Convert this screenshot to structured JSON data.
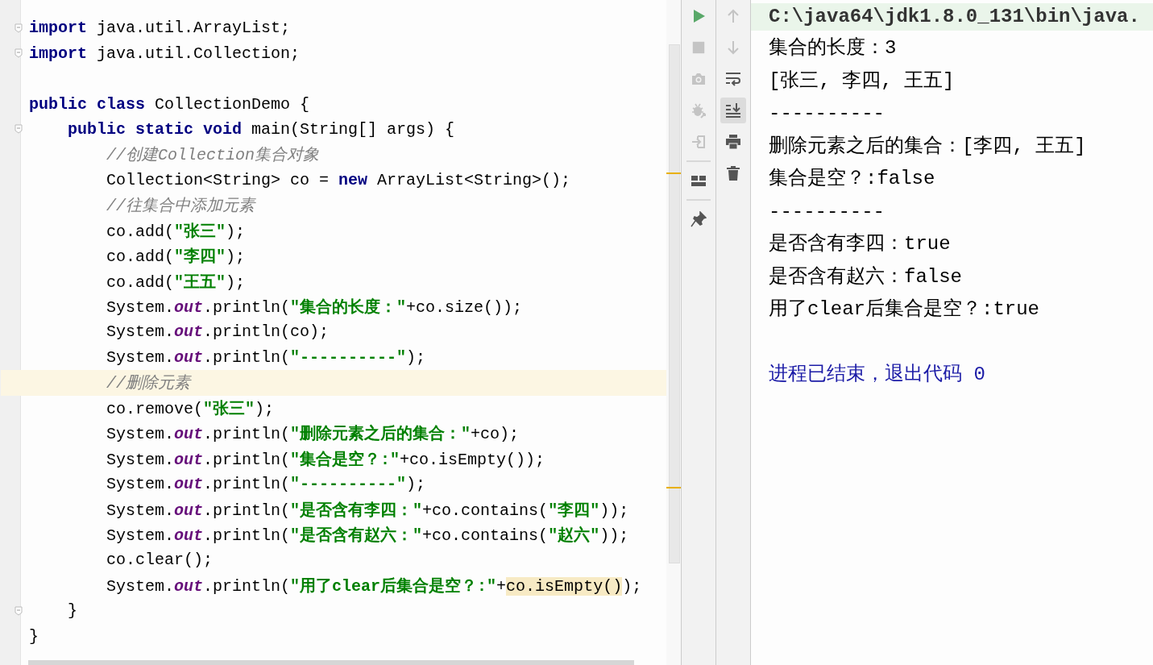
{
  "editor": {
    "lines": [
      {
        "kind": "code",
        "current": false,
        "fold_marker": true,
        "tokens": [
          {
            "kind": "kw",
            "text": "import"
          },
          {
            "kind": "plain",
            "text": " java.util.ArrayList;"
          }
        ]
      },
      {
        "kind": "code",
        "current": false,
        "fold_marker": true,
        "tokens": [
          {
            "kind": "kw",
            "text": "import"
          },
          {
            "kind": "plain",
            "text": " java.util.Collection;"
          }
        ]
      },
      {
        "kind": "blank",
        "current": false,
        "fold_marker": false
      },
      {
        "kind": "code",
        "current": false,
        "fold_marker": false,
        "tokens": [
          {
            "kind": "kw",
            "text": "public class"
          },
          {
            "kind": "plain",
            "text": " CollectionDemo {"
          }
        ]
      },
      {
        "kind": "code",
        "current": false,
        "fold_marker": true,
        "tokens": [
          {
            "kind": "kw",
            "text": "    public static void"
          },
          {
            "kind": "plain",
            "text": " main(String[] args) {"
          }
        ]
      },
      {
        "kind": "code",
        "current": false,
        "fold_marker": false,
        "tokens": [
          {
            "kind": "comment",
            "text": "        //创建Collection集合对象"
          }
        ]
      },
      {
        "kind": "code",
        "current": false,
        "fold_marker": false,
        "tokens": [
          {
            "kind": "plain",
            "text": "        Collection<String> co = "
          },
          {
            "kind": "kw",
            "text": "new"
          },
          {
            "kind": "plain",
            "text": " ArrayList<String>();"
          }
        ]
      },
      {
        "kind": "code",
        "current": false,
        "fold_marker": false,
        "tokens": [
          {
            "kind": "comment",
            "text": "        //往集合中添加元素"
          }
        ]
      },
      {
        "kind": "code",
        "current": false,
        "fold_marker": false,
        "tokens": [
          {
            "kind": "plain",
            "text": "        co.add("
          },
          {
            "kind": "str",
            "text": "\"张三\""
          },
          {
            "kind": "plain",
            "text": ");"
          }
        ]
      },
      {
        "kind": "code",
        "current": false,
        "fold_marker": false,
        "tokens": [
          {
            "kind": "plain",
            "text": "        co.add("
          },
          {
            "kind": "str",
            "text": "\"李四\""
          },
          {
            "kind": "plain",
            "text": ");"
          }
        ]
      },
      {
        "kind": "code",
        "current": false,
        "fold_marker": false,
        "tokens": [
          {
            "kind": "plain",
            "text": "        co.add("
          },
          {
            "kind": "str",
            "text": "\"王五\""
          },
          {
            "kind": "plain",
            "text": ");"
          }
        ]
      },
      {
        "kind": "code",
        "current": false,
        "fold_marker": false,
        "tokens": [
          {
            "kind": "plain",
            "text": "        System."
          },
          {
            "kind": "field",
            "text": "out"
          },
          {
            "kind": "plain",
            "text": ".println("
          },
          {
            "kind": "str",
            "text": "\"集合的长度：\""
          },
          {
            "kind": "plain",
            "text": "+co.size());"
          }
        ]
      },
      {
        "kind": "code",
        "current": false,
        "fold_marker": false,
        "tokens": [
          {
            "kind": "plain",
            "text": "        System."
          },
          {
            "kind": "field",
            "text": "out"
          },
          {
            "kind": "plain",
            "text": ".println(co);"
          }
        ]
      },
      {
        "kind": "code",
        "current": false,
        "fold_marker": false,
        "tokens": [
          {
            "kind": "plain",
            "text": "        System."
          },
          {
            "kind": "field",
            "text": "out"
          },
          {
            "kind": "plain",
            "text": ".println("
          },
          {
            "kind": "str",
            "text": "\"----------\""
          },
          {
            "kind": "plain",
            "text": ");"
          }
        ]
      },
      {
        "kind": "code",
        "current": true,
        "fold_marker": false,
        "tokens": [
          {
            "kind": "comment",
            "text": "        //删除元素"
          }
        ]
      },
      {
        "kind": "code",
        "current": false,
        "fold_marker": false,
        "tokens": [
          {
            "kind": "plain",
            "text": "        co.remove("
          },
          {
            "kind": "str",
            "text": "\"张三\""
          },
          {
            "kind": "plain",
            "text": ");"
          }
        ]
      },
      {
        "kind": "code",
        "current": false,
        "fold_marker": false,
        "tokens": [
          {
            "kind": "plain",
            "text": "        System."
          },
          {
            "kind": "field",
            "text": "out"
          },
          {
            "kind": "plain",
            "text": ".println("
          },
          {
            "kind": "str",
            "text": "\"删除元素之后的集合：\""
          },
          {
            "kind": "plain",
            "text": "+co);"
          }
        ]
      },
      {
        "kind": "code",
        "current": false,
        "fold_marker": false,
        "tokens": [
          {
            "kind": "plain",
            "text": "        System."
          },
          {
            "kind": "field",
            "text": "out"
          },
          {
            "kind": "plain",
            "text": ".println("
          },
          {
            "kind": "str",
            "text": "\"集合是空？:\""
          },
          {
            "kind": "plain",
            "text": "+co.isEmpty());"
          }
        ]
      },
      {
        "kind": "code",
        "current": false,
        "fold_marker": false,
        "tokens": [
          {
            "kind": "plain",
            "text": "        System."
          },
          {
            "kind": "field",
            "text": "out"
          },
          {
            "kind": "plain",
            "text": ".println("
          },
          {
            "kind": "str",
            "text": "\"----------\""
          },
          {
            "kind": "plain",
            "text": ");"
          }
        ]
      },
      {
        "kind": "code",
        "current": false,
        "fold_marker": false,
        "tokens": [
          {
            "kind": "plain",
            "text": "        System."
          },
          {
            "kind": "field",
            "text": "out"
          },
          {
            "kind": "plain",
            "text": ".println("
          },
          {
            "kind": "str",
            "text": "\"是否含有李四：\""
          },
          {
            "kind": "plain",
            "text": "+co.contains("
          },
          {
            "kind": "str",
            "text": "\"李四\""
          },
          {
            "kind": "plain",
            "text": "));"
          }
        ]
      },
      {
        "kind": "code",
        "current": false,
        "fold_marker": false,
        "tokens": [
          {
            "kind": "plain",
            "text": "        System."
          },
          {
            "kind": "field",
            "text": "out"
          },
          {
            "kind": "plain",
            "text": ".println("
          },
          {
            "kind": "str",
            "text": "\"是否含有赵六：\""
          },
          {
            "kind": "plain",
            "text": "+co.contains("
          },
          {
            "kind": "str",
            "text": "\"赵六\""
          },
          {
            "kind": "plain",
            "text": "));"
          }
        ]
      },
      {
        "kind": "code",
        "current": false,
        "fold_marker": false,
        "tokens": [
          {
            "kind": "plain",
            "text": "        co.clear();"
          }
        ]
      },
      {
        "kind": "code",
        "current": false,
        "fold_marker": false,
        "tokens": [
          {
            "kind": "plain",
            "text": "        System."
          },
          {
            "kind": "field",
            "text": "out"
          },
          {
            "kind": "plain",
            "text": ".println("
          },
          {
            "kind": "str",
            "text": "\"用了clear后集合是空？:\""
          },
          {
            "kind": "plain",
            "text": "+"
          },
          {
            "kind": "matched",
            "text": "co.isEmpty()"
          },
          {
            "kind": "plain",
            "text": ");"
          }
        ]
      },
      {
        "kind": "code",
        "current": false,
        "fold_marker": true,
        "tokens": [
          {
            "kind": "plain",
            "text": "    }"
          }
        ]
      },
      {
        "kind": "code",
        "current": false,
        "fold_marker": false,
        "tokens": [
          {
            "kind": "plain",
            "text": "}"
          }
        ]
      }
    ]
  },
  "run_toolbar": [
    {
      "kind": "run",
      "disabled": false
    },
    {
      "kind": "stop",
      "disabled": true
    },
    {
      "kind": "camera",
      "disabled": true
    },
    {
      "kind": "bug",
      "disabled": true
    },
    {
      "kind": "enter",
      "disabled": true
    },
    {
      "kind": "separator"
    },
    {
      "kind": "layout",
      "disabled": false
    },
    {
      "kind": "separator"
    },
    {
      "kind": "pin",
      "disabled": false
    }
  ],
  "console_toolbar": [
    {
      "kind": "up",
      "disabled": true,
      "selected": false
    },
    {
      "kind": "down",
      "disabled": true,
      "selected": false
    },
    {
      "kind": "wrap",
      "disabled": false,
      "selected": false
    },
    {
      "kind": "scroll-end",
      "disabled": false,
      "selected": true
    },
    {
      "kind": "print",
      "disabled": false,
      "selected": false
    },
    {
      "kind": "trash",
      "disabled": false,
      "selected": false
    }
  ],
  "console": [
    {
      "kind": "command",
      "text": "C:\\java64\\jdk1.8.0_131\\bin\\java."
    },
    {
      "kind": "output",
      "text": "集合的长度：3"
    },
    {
      "kind": "output",
      "text": "[张三, 李四, 王五]"
    },
    {
      "kind": "output",
      "text": "----------"
    },
    {
      "kind": "output",
      "text": "删除元素之后的集合：[李四, 王五]"
    },
    {
      "kind": "output",
      "text": "集合是空？:false"
    },
    {
      "kind": "output",
      "text": "----------"
    },
    {
      "kind": "output",
      "text": "是否含有李四：true"
    },
    {
      "kind": "output",
      "text": "是否含有赵六：false"
    },
    {
      "kind": "output",
      "text": "用了clear后集合是空？:true"
    },
    {
      "kind": "exit",
      "text": "进程已结束，退出代码 0"
    }
  ]
}
